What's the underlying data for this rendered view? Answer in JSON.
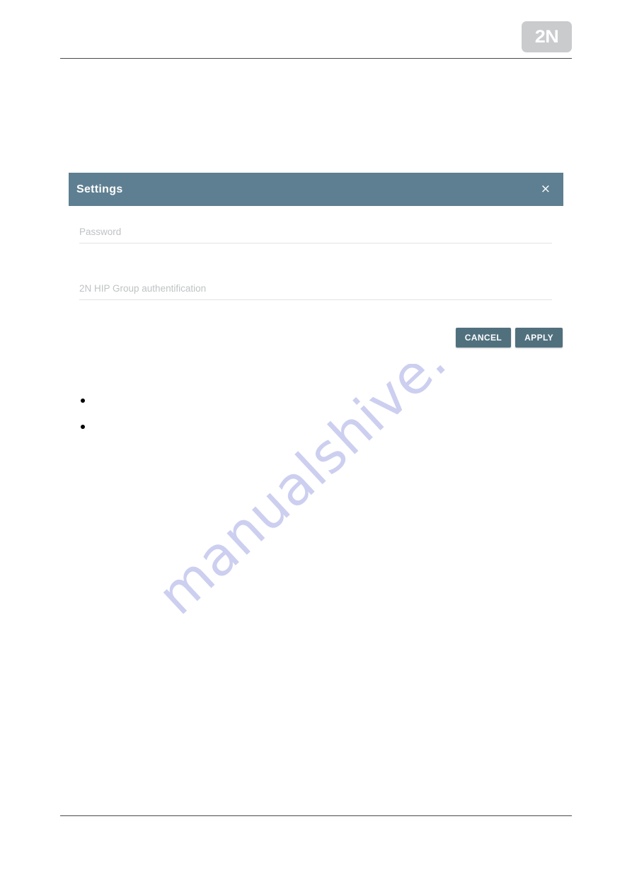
{
  "page": {
    "background_color": "#ffffff",
    "rule_color": "#4a4a4a"
  },
  "brand": {
    "logo_text": "2N",
    "logo_icon": "2n-logo-icon",
    "logo_background": "#c9cbcd",
    "logo_foreground": "#ffffff"
  },
  "watermark": {
    "text": "manualshive.com",
    "color": "#cdcff0"
  },
  "dialog": {
    "title": "Settings",
    "header_color": "#5e7f91",
    "close_icon": "close-icon",
    "close_label": "×",
    "fields": [
      {
        "name": "password",
        "placeholder": "Password",
        "value": ""
      },
      {
        "name": "hip-group-authentification",
        "placeholder": "2N HIP Group authentification",
        "value": ""
      }
    ],
    "buttons": [
      {
        "name": "cancel",
        "label": "CANCEL",
        "color": "#51707e"
      },
      {
        "name": "apply",
        "label": "APPLY",
        "color": "#51707e"
      }
    ]
  },
  "bullets": [
    {
      "text": ""
    },
    {
      "text": ""
    }
  ]
}
